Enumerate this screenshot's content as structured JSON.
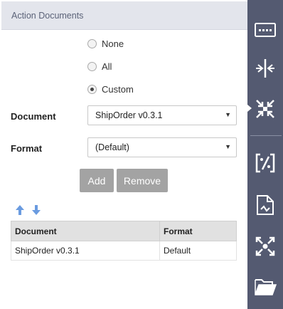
{
  "panel": {
    "title": "Action Documents"
  },
  "selection": {
    "options": [
      "None",
      "All",
      "Custom"
    ],
    "selected": "Custom"
  },
  "document_field": {
    "label": "Document",
    "value": "ShipOrder v0.3.1"
  },
  "format_field": {
    "label": "Format",
    "value": "(Default)"
  },
  "buttons": {
    "add": "Add",
    "remove": "Remove"
  },
  "table": {
    "headers": [
      "Document",
      "Format"
    ],
    "rows": [
      [
        "ShipOrder v0.3.1",
        "Default"
      ]
    ]
  },
  "sidebar": {
    "icons": [
      "screen-icon",
      "split-merge-icon",
      "collapse-icon",
      "script-icon",
      "document-icon",
      "expand-icon",
      "folder-icon"
    ],
    "active": "collapse-icon"
  },
  "colors": {
    "sidebar_bg": "#545a71",
    "header_bg": "#e3e5ec",
    "button_bg": "#a3a3a3",
    "arrow_blue": "#6a9be0"
  }
}
